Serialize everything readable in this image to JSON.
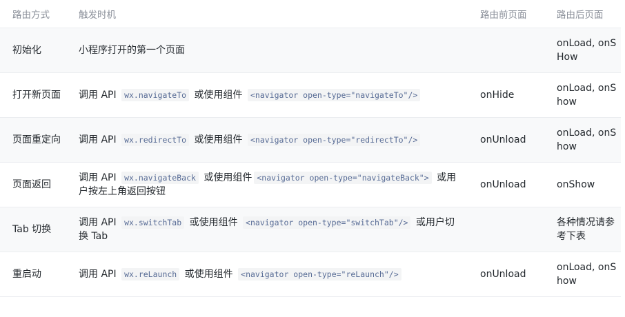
{
  "headers": [
    "路由方式",
    "触发时机",
    "路由前页面",
    "路由后页面"
  ],
  "rows": [
    {
      "method": "初始化",
      "trigger": [
        {
          "t": "text",
          "v": "小程序打开的第一个页面"
        }
      ],
      "before": "",
      "after": "onLoad, onSHow"
    },
    {
      "method": "打开新页面",
      "trigger": [
        {
          "t": "text",
          "v": "调用 API "
        },
        {
          "t": "code",
          "v": "wx.navigateTo"
        },
        {
          "t": "text",
          "v": " 或使用组件 "
        },
        {
          "t": "code",
          "v": "<navigator open-type=\"navigateTo\"/>"
        }
      ],
      "before": "onHide",
      "after": "onLoad, onShow"
    },
    {
      "method": "页面重定向",
      "trigger": [
        {
          "t": "text",
          "v": "调用 API "
        },
        {
          "t": "code",
          "v": "wx.redirectTo"
        },
        {
          "t": "text",
          "v": " 或使用组件 "
        },
        {
          "t": "code",
          "v": "<navigator open-type=\"redirectTo\"/>"
        }
      ],
      "before": "onUnload",
      "after": "onLoad, onShow"
    },
    {
      "method": "页面返回",
      "trigger": [
        {
          "t": "text",
          "v": "调用 API "
        },
        {
          "t": "code",
          "v": "wx.navigateBack"
        },
        {
          "t": "text",
          "v": " 或使用组件"
        },
        {
          "t": "code",
          "v": "<navigator open-type=\"navigateBack\">"
        },
        {
          "t": "text",
          "v": " 或用户按左上角返回按钮"
        }
      ],
      "before": "onUnload",
      "after": "onShow"
    },
    {
      "method": "Tab 切换",
      "trigger": [
        {
          "t": "text",
          "v": "调用 API "
        },
        {
          "t": "code",
          "v": "wx.switchTab"
        },
        {
          "t": "text",
          "v": " 或使用组件 "
        },
        {
          "t": "code",
          "v": "<navigator open-type=\"switchTab\"/>"
        },
        {
          "t": "text",
          "v": " 或用户切换 Tab"
        }
      ],
      "before": "",
      "after": "各种情况请参考下表"
    },
    {
      "method": "重启动",
      "trigger": [
        {
          "t": "text",
          "v": "调用 API "
        },
        {
          "t": "code",
          "v": "wx.reLaunch"
        },
        {
          "t": "text",
          "v": " 或使用组件 "
        },
        {
          "t": "code",
          "v": "<navigator open-type=\"reLaunch\"/>"
        }
      ],
      "before": "onUnload",
      "after": "onLoad, onShow"
    }
  ]
}
